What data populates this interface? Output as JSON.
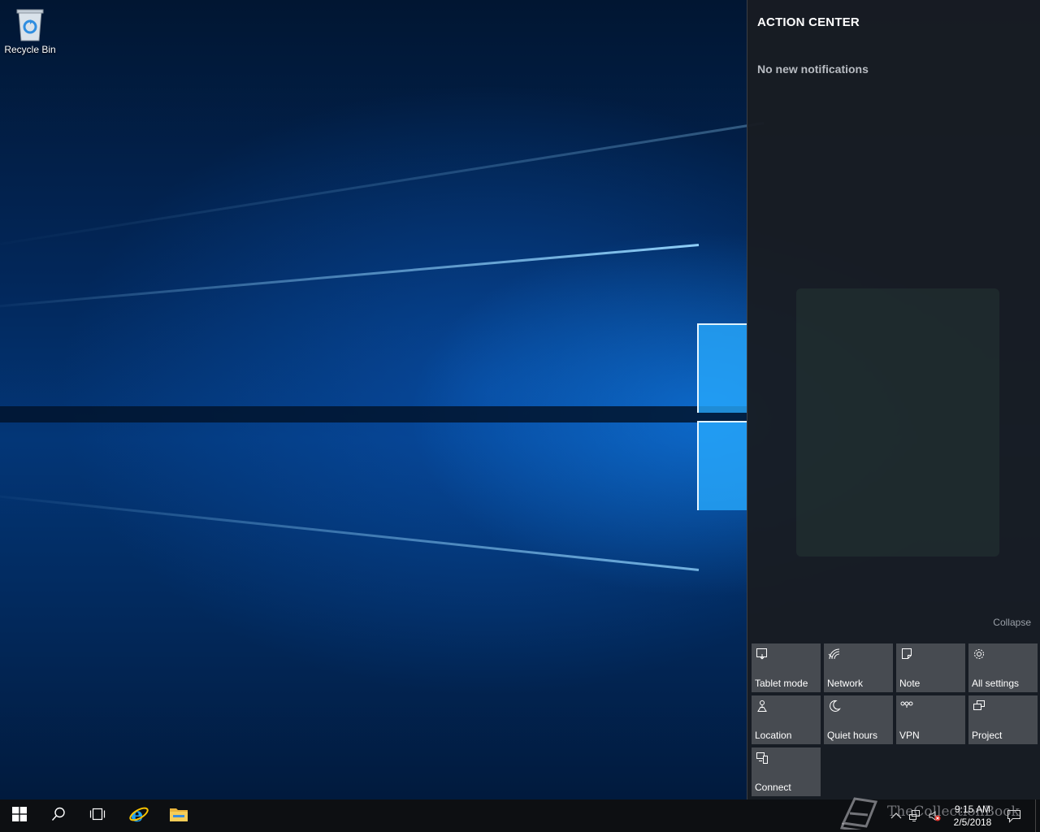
{
  "desktop": {
    "icons": [
      {
        "label": "Recycle Bin",
        "icon": "recycle-bin-icon"
      }
    ]
  },
  "action_center": {
    "title": "ACTION CENTER",
    "empty_message": "No new notifications",
    "collapse_label": "Collapse",
    "quick_actions": [
      {
        "label": "Tablet mode",
        "icon": "tablet-mode-icon"
      },
      {
        "label": "Network",
        "icon": "network-icon"
      },
      {
        "label": "Note",
        "icon": "note-icon"
      },
      {
        "label": "All settings",
        "icon": "settings-gear-icon"
      },
      {
        "label": "Location",
        "icon": "location-icon"
      },
      {
        "label": "Quiet hours",
        "icon": "moon-icon"
      },
      {
        "label": "VPN",
        "icon": "vpn-icon"
      },
      {
        "label": "Project",
        "icon": "project-icon"
      },
      {
        "label": "Connect",
        "icon": "connect-icon"
      }
    ]
  },
  "taskbar": {
    "buttons": [
      {
        "name": "start",
        "icon": "windows-logo-icon"
      },
      {
        "name": "search",
        "icon": "search-icon"
      },
      {
        "name": "task-view",
        "icon": "task-view-icon"
      },
      {
        "name": "internet-explorer",
        "icon": "internet-explorer-icon"
      },
      {
        "name": "file-explorer",
        "icon": "folder-icon"
      }
    ],
    "tray": {
      "icons": [
        "chevron-up-icon",
        "network-wired-icon",
        "volume-muted-icon"
      ],
      "time": "9:15 AM",
      "date": "2/5/2018",
      "notification_icon": "action-center-icon"
    }
  },
  "watermark": {
    "text": "TheCollectionBook"
  },
  "colors": {
    "accent": "#0078d7",
    "taskbar": "#0d0f12",
    "action_center_bg": "#181c22",
    "tile_bg": "#474b51"
  }
}
